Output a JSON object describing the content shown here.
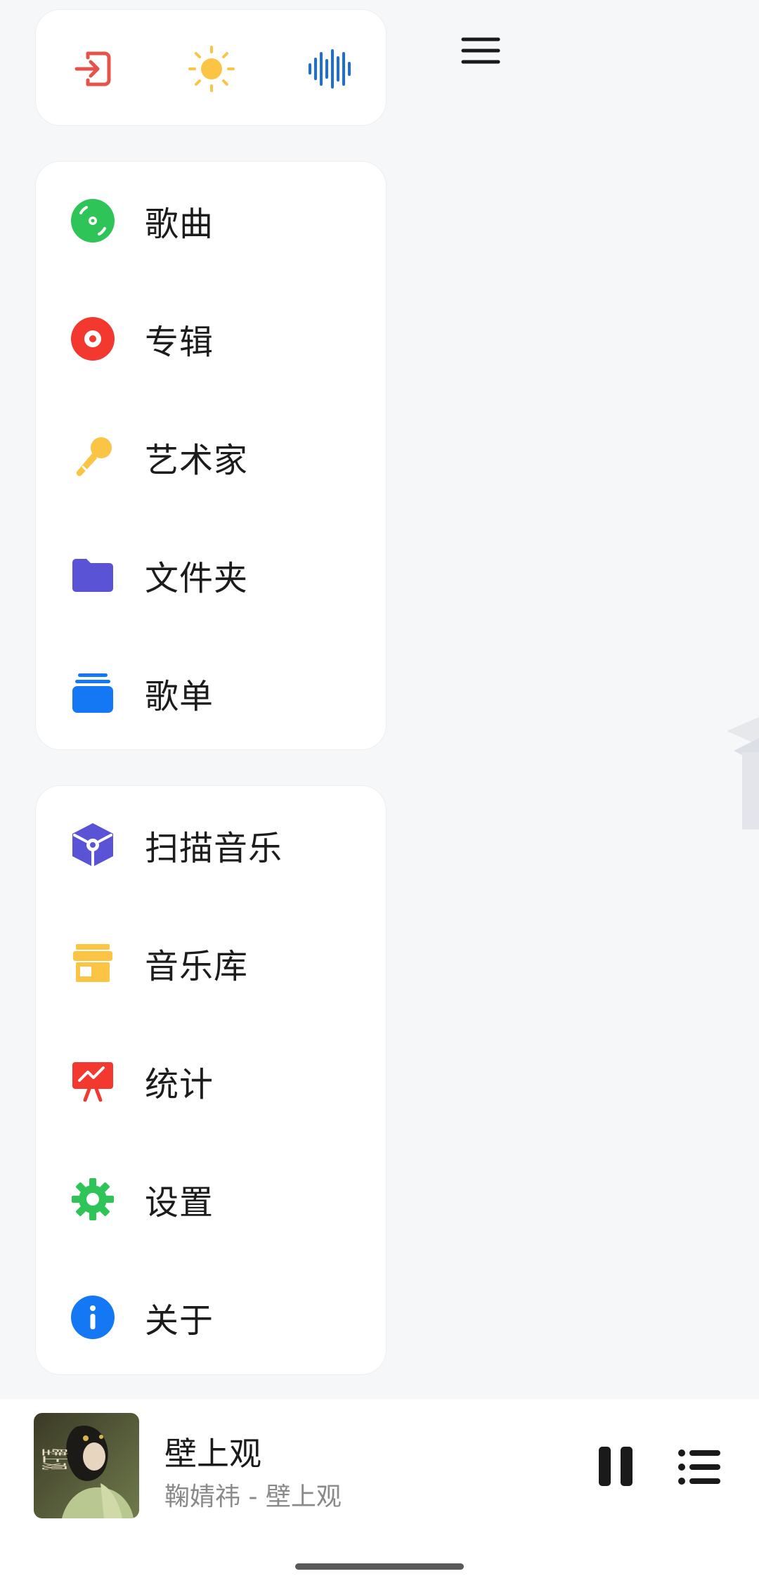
{
  "top_bar": {
    "icons": [
      "exit-icon",
      "brightness-icon",
      "soundwave-icon"
    ],
    "menu_icon": "hamburger-menu-icon"
  },
  "library_menu": {
    "items": [
      {
        "label": "歌曲",
        "icon": "vinyl-disc-icon",
        "color": "#2ec458"
      },
      {
        "label": "专辑",
        "icon": "album-record-icon",
        "color": "#f2382f"
      },
      {
        "label": "艺术家",
        "icon": "microphone-icon",
        "color": "#fcc445"
      },
      {
        "label": "文件夹",
        "icon": "folder-icon",
        "color": "#5a53d6"
      },
      {
        "label": "歌单",
        "icon": "playlist-stack-icon",
        "color": "#1478f5"
      }
    ]
  },
  "tools_menu": {
    "items": [
      {
        "label": "扫描音乐",
        "icon": "scan-cube-icon",
        "color": "#5a53d6"
      },
      {
        "label": "音乐库",
        "icon": "store-icon",
        "color": "#fcc445"
      },
      {
        "label": "统计",
        "icon": "presentation-chart-icon",
        "color": "#f2382f"
      },
      {
        "label": "设置",
        "icon": "gear-icon",
        "color": "#2ec458"
      },
      {
        "label": "关于",
        "icon": "info-icon",
        "color": "#1478f5"
      }
    ]
  },
  "now_playing": {
    "title": "壁上观",
    "subtitle": "鞠婧祎 - 壁上观",
    "cover_text": "壁上观"
  },
  "colors": {
    "background": "#f6f7f9",
    "card": "#ffffff",
    "exit": "#e5534b",
    "sun": "#fcc445",
    "wave": "#1b6fd6"
  }
}
